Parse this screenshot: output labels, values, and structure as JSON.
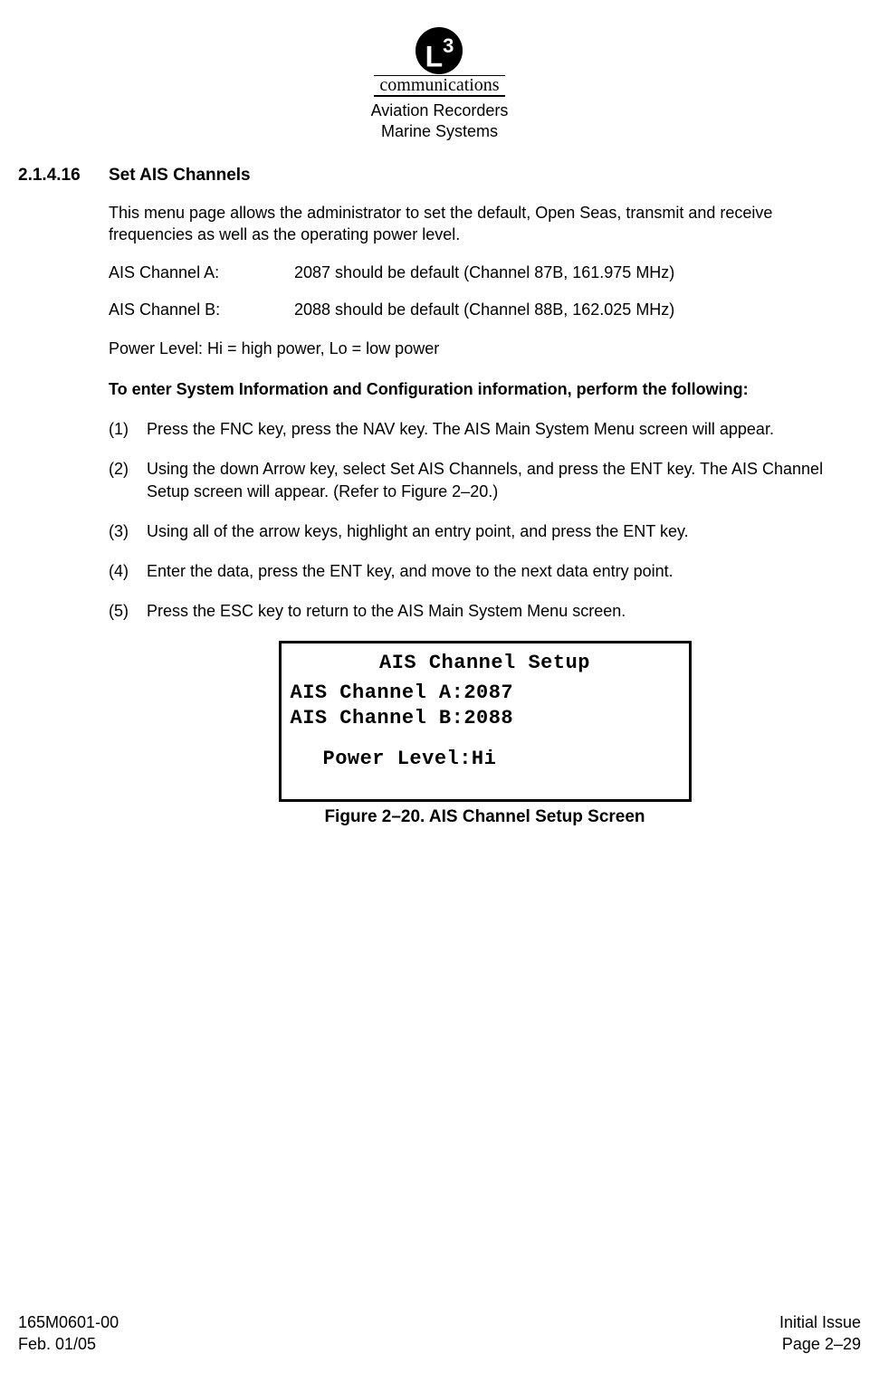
{
  "header": {
    "logo_letter": "L",
    "logo_number": "3",
    "logo_word": "communications",
    "line1": "Aviation Recorders",
    "line2": "Marine Systems"
  },
  "section": {
    "number": "2.1.4.16",
    "title": "Set AIS Channels"
  },
  "intro": "This menu page allows the administrator to set the default, Open Seas, transmit and receive frequencies as well as the operating power level.",
  "defs": {
    "chA_label": "AIS Channel A:",
    "chA_val": "2087 should be default (Channel 87B, 161.975 MHz)",
    "chB_label": "AIS Channel B:",
    "chB_val": "2088 should be default (Channel 88B, 162.025 MHz)",
    "power": "Power Level:  Hi = high power, Lo = low power"
  },
  "instr_heading": "To enter System Information and Configuration information, perform the following:",
  "steps": [
    "Press the FNC  key, press the NAV key. The AIS Main System Menu screen will appear.",
    "Using the down Arrow key, select Set AIS Channels, and press the ENT key. The AIS Channel Setup screen will appear. (Refer to Figure 2–20.)",
    "Using all of the arrow keys, highlight an entry point, and press the ENT key.",
    "Enter the data, press the ENT key, and move to the next data entry point.",
    "Press the ESC key to return to the AIS Main System Menu screen."
  ],
  "screen": {
    "title": "AIS Channel Setup",
    "lineA": "AIS Channel A:2087",
    "lineB": "AIS Channel B:2088",
    "power": "Power Level:Hi"
  },
  "figure_caption": "Figure 2–20.  AIS Channel Setup Screen",
  "footer": {
    "doc_num": "165M0601-00",
    "date": "Feb. 01/05",
    "issue": "Initial Issue",
    "page": "Page 2–29"
  }
}
